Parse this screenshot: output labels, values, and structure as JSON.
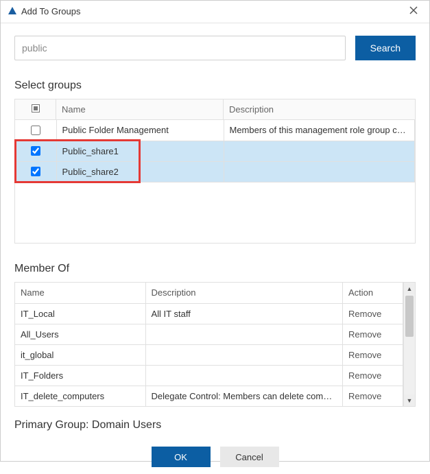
{
  "dialog": {
    "title": "Add To Groups"
  },
  "search": {
    "value": "public",
    "button_label": "Search"
  },
  "groups": {
    "section_title": "Select groups",
    "columns": {
      "name": "Name",
      "description": "Description"
    },
    "rows": [
      {
        "checked": false,
        "name": "Public Folder Management",
        "description": "Members of this management role group can man…",
        "selected": false
      },
      {
        "checked": true,
        "name": "Public_share1",
        "description": "",
        "selected": true
      },
      {
        "checked": true,
        "name": "Public_share2",
        "description": "",
        "selected": true
      }
    ]
  },
  "member_of": {
    "section_title": "Member Of",
    "columns": {
      "name": "Name",
      "description": "Description",
      "action": "Action"
    },
    "action_label": "Remove",
    "rows": [
      {
        "name": "IT_Local",
        "description": "All IT staff"
      },
      {
        "name": "All_Users",
        "description": ""
      },
      {
        "name": "it_global",
        "description": ""
      },
      {
        "name": "IT_Folders",
        "description": ""
      },
      {
        "name": "IT_delete_computers",
        "description": "Delegate Control: Members can delete computer obj…"
      }
    ]
  },
  "primary_group": {
    "label": "Primary Group: Domain Users"
  },
  "footer": {
    "ok": "OK",
    "cancel": "Cancel"
  }
}
